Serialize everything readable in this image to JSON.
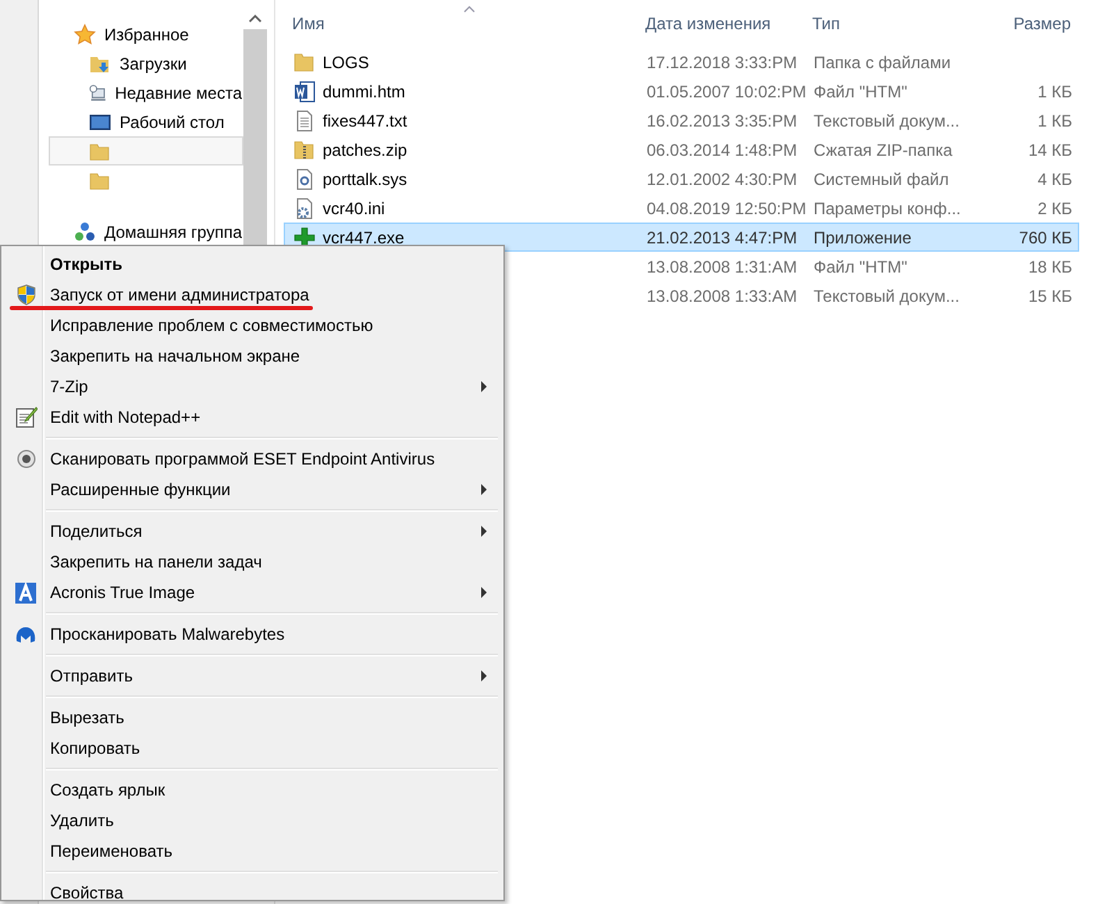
{
  "navigation": [
    {
      "label": "Избранное",
      "kind": "favorites",
      "selected": false,
      "children": [
        {
          "label": "Загрузки",
          "kind": "downloads",
          "selected": false
        },
        {
          "label": "Недавние места",
          "kind": "recent",
          "selected": false
        },
        {
          "label": "Рабочий стол",
          "kind": "desktop",
          "selected": false
        },
        {
          "kind": "folder",
          "selected": true
        },
        {
          "kind": "folder",
          "selected": false
        }
      ]
    },
    {
      "label": "Домашняя группа",
      "kind": "homegroup",
      "selected": false
    }
  ],
  "file_list": {
    "columns": [
      "Имя",
      "Дата изменения",
      "Тип",
      "Размер"
    ],
    "rows": [
      {
        "name": "LOGS",
        "kind": "folder",
        "modified": "17.12.2018 3:33:PM",
        "type": "Папка с файлами",
        "selected": false
      },
      {
        "name": "dummi.htm",
        "kind": "word",
        "modified": "01.05.2007 10:02:PM",
        "type": "Файл \"HTM\"",
        "size": "1 КБ",
        "selected": false
      },
      {
        "name": "fixes447.txt",
        "kind": "text",
        "modified": "16.02.2013 3:35:PM",
        "type": "Текстовый докум...",
        "size": "1 КБ",
        "selected": false
      },
      {
        "name": "patches.zip",
        "kind": "zip",
        "modified": "06.03.2014 1:48:PM",
        "type": "Сжатая ZIP-папка",
        "size": "14 КБ",
        "selected": false
      },
      {
        "name": "porttalk.sys",
        "kind": "system",
        "modified": "12.01.2002 4:30:PM",
        "type": "Системный файл",
        "size": "4 КБ",
        "selected": false
      },
      {
        "name": "vcr40.ini",
        "kind": "settings",
        "modified": "04.08.2019 12:50:PM",
        "type": "Параметры конф...",
        "size": "2 КБ",
        "selected": false
      },
      {
        "name": "vcr447.exe",
        "kind": "app",
        "modified": "21.02.2013 4:47:PM",
        "type": "Приложение",
        "size": "760 КБ",
        "selected": true
      },
      {
        "modified": "13.08.2008 1:31:AM",
        "type": "Файл \"HTM\"",
        "size": "18 КБ",
        "selected": false
      },
      {
        "modified": "13.08.2008 1:33:AM",
        "type": "Текстовый докум...",
        "size": "15 КБ",
        "selected": false
      }
    ]
  },
  "context_menu": [
    [
      {
        "label": "Открыть",
        "default": true
      },
      {
        "label": "Запуск от имени администратора",
        "kind": "admin",
        "underlined": true
      },
      {
        "label": "Исправление проблем с совместимостью"
      },
      {
        "label": "Закрепить на начальном экране"
      },
      {
        "label": "7-Zip",
        "submenu": true
      },
      {
        "label": "Edit with Notepad++",
        "kind": "editor"
      }
    ],
    [
      {
        "label": "Сканировать программой ESET Endpoint Antivirus",
        "kind": "antivirus"
      },
      {
        "label": "Расширенные функции",
        "submenu": true
      }
    ],
    [
      {
        "label": "Поделиться",
        "submenu": true
      },
      {
        "label": "Закрепить на панели задач"
      },
      {
        "label": "Acronis True Image",
        "kind": "backup",
        "submenu": true
      }
    ],
    [
      {
        "label": "Просканировать Malwarebytes",
        "kind": "malware"
      }
    ],
    [
      {
        "label": "Отправить",
        "submenu": true
      }
    ],
    [
      {
        "label": "Вырезать"
      },
      {
        "label": "Копировать"
      }
    ],
    [
      {
        "label": "Создать ярлык"
      },
      {
        "label": "Удалить"
      },
      {
        "label": "Переименовать"
      }
    ],
    [
      {
        "label": "Свойства"
      }
    ]
  ]
}
